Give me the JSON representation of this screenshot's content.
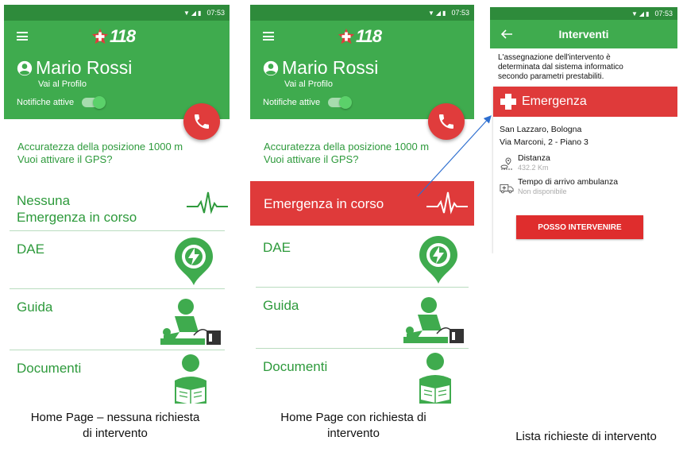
{
  "status_bar": {
    "time": "07:53",
    "icons": "▼◢▮"
  },
  "app": {
    "logo_text": "118"
  },
  "user": {
    "name": "Mario Rossi",
    "profile_link": "Vai al Profilo"
  },
  "notifications": {
    "label": "Notifiche attive",
    "enabled": true
  },
  "gps": {
    "line1": "Accuratezza della posizione 1000 m",
    "line2": "Vuoi attivare il GPS?"
  },
  "home_idle": {
    "emergency_line1": "Nessuna",
    "emergency_line2": "Emergenza in corso"
  },
  "home_active": {
    "emergency_label": "Emergenza in corso"
  },
  "menu": {
    "dae": "DAE",
    "guida": "Guida",
    "documenti": "Documenti"
  },
  "captions": {
    "phone1_line1": "Home Page – nessuna richiesta",
    "phone1_line2": "di intervento",
    "phone2_line1": "Home Page con richiesta di",
    "phone2_line2": "intervento",
    "phone3": "Lista richieste di intervento"
  },
  "interventi": {
    "title": "Interventi",
    "info_line1": "L'assegnazione dell'intervento è",
    "info_line2": "determinata dal sistema informatico",
    "info_line3": "secondo parametri prestabiliti.",
    "banner": "Emergenza",
    "address_line1": "San Lazzaro, Bologna",
    "address_line2": "Via Marconi, 2 - Piano 3",
    "distance_label": "Distanza",
    "distance_value": "432.2 Km",
    "ambulance_label": "Tempo di arrivo ambulanza",
    "ambulance_value": "Non disponibile",
    "button": "POSSO INTERVENIRE"
  },
  "colors": {
    "header_green": "#3fab4e",
    "status_green": "#2e8b3b",
    "text_green": "#2e9a3c",
    "emergency_red": "#df3a3a"
  },
  "icons": [
    "menu-icon",
    "user-icon",
    "phone-icon",
    "heartbeat-icon",
    "aed-pin-icon",
    "cpr-icon",
    "reading-person-icon",
    "back-arrow-icon",
    "red-cross-icon",
    "distance-pin-icon",
    "ambulance-icon"
  ]
}
